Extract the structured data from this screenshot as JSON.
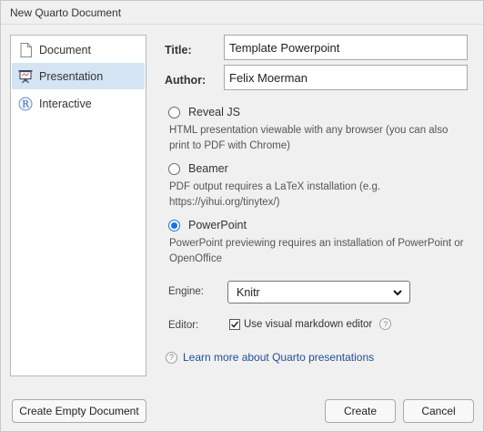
{
  "window": {
    "title": "New Quarto Document"
  },
  "sidebar": {
    "items": [
      {
        "label": "Document",
        "icon": "document-icon",
        "selected": false
      },
      {
        "label": "Presentation",
        "icon": "presentation-icon",
        "selected": true
      },
      {
        "label": "Interactive",
        "icon": "r-icon",
        "selected": false
      }
    ]
  },
  "form": {
    "title_label": "Title:",
    "title_value": "Template Powerpoint",
    "author_label": "Author:",
    "author_value": "Felix Moerman",
    "formats": [
      {
        "label": "Reveal JS",
        "checked": false,
        "description": "HTML presentation viewable with any browser (you can also print to PDF with Chrome)"
      },
      {
        "label": "Beamer",
        "checked": false,
        "description": "PDF output requires a LaTeX installation (e.g. https://yihui.org/tinytex/)"
      },
      {
        "label": "PowerPoint",
        "checked": true,
        "description": "PowerPoint previewing requires an installation of PowerPoint or OpenOffice"
      }
    ],
    "engine_label": "Engine:",
    "engine_value": "Knitr",
    "editor_label": "Editor:",
    "editor_checkbox_label": "Use visual markdown editor",
    "editor_checked": true,
    "help_link": "Learn more about Quarto presentations"
  },
  "buttons": {
    "create_empty": "Create Empty Document",
    "create": "Create",
    "cancel": "Cancel"
  },
  "colors": {
    "accent": "#1a73e8",
    "selection": "#d5e4f2",
    "link": "#1f4e9c"
  }
}
